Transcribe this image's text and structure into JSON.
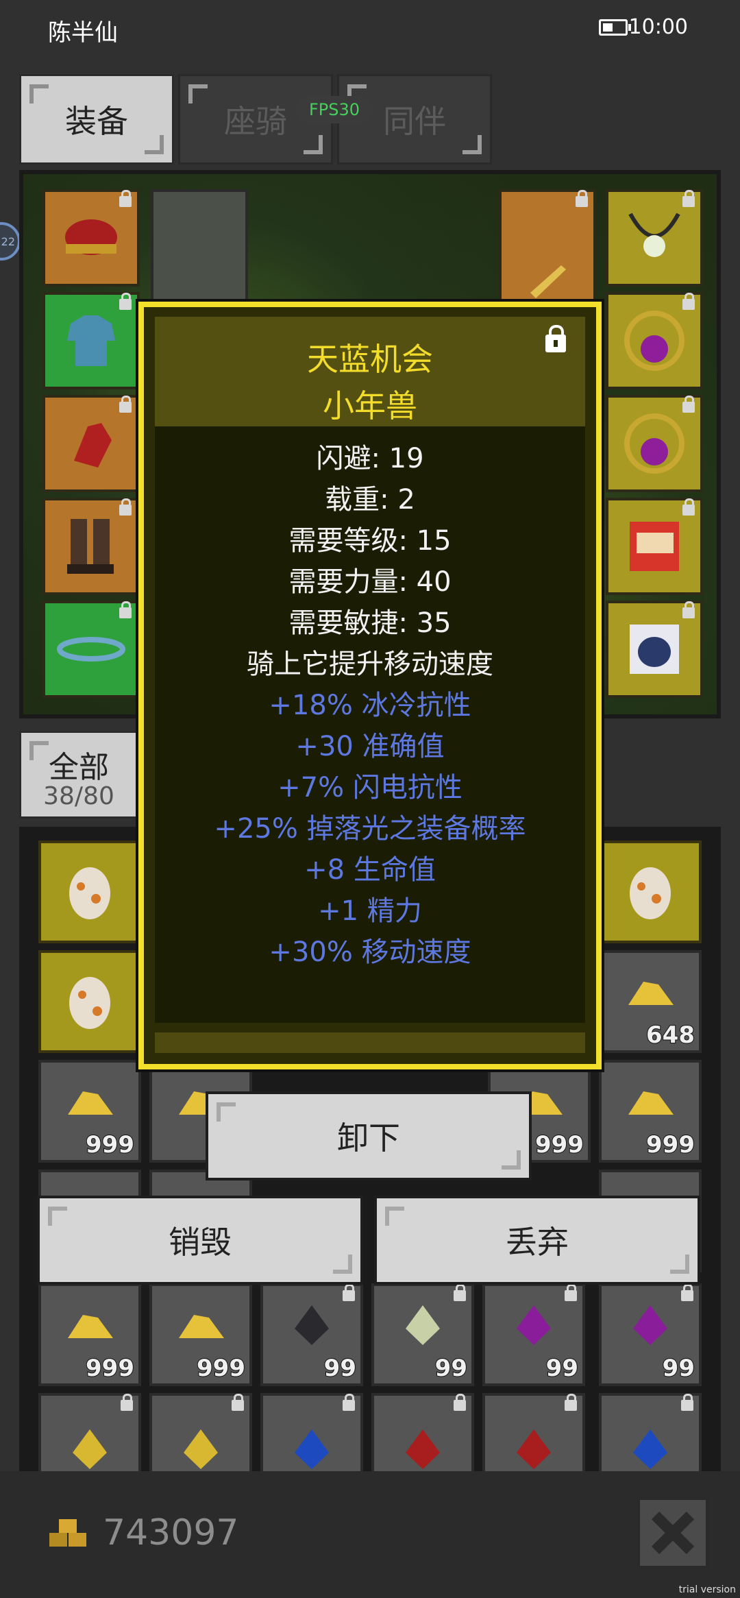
{
  "status_bar": {
    "name": "陈半仙",
    "time": "10:00"
  },
  "tabs": [
    {
      "label": "装备",
      "active": true
    },
    {
      "label": "座骑",
      "active": false
    },
    {
      "label": "同伴",
      "active": false
    }
  ],
  "fps": "FPS30",
  "side_badge": "22",
  "tooltip": {
    "title": "天蓝机会",
    "subtitle": "小年兽",
    "stats": [
      "闪避: 19",
      "载重: 2",
      "需要等级: 15",
      "需要力量: 40",
      "需要敏捷: 35",
      "骑上它提升移动速度"
    ],
    "bonuses": [
      "+18% 冰冷抗性",
      "+30 准确值",
      "+7% 闪电抗性",
      "+25% 掉落光之装备概率",
      "+8 生命值",
      "+1 精力",
      "+30% 移动速度"
    ],
    "colors": {
      "title": "#f3dd2a",
      "stat": "#f2f2f2",
      "bonus": "#5d78e0",
      "border": "#f2e02a"
    }
  },
  "inventory": {
    "filter_label": "全部",
    "count": "38/80",
    "quantities": {
      "row1_last": "648",
      "row2": [
        "999",
        "999",
        "999",
        "999"
      ],
      "row4": [
        "999",
        "999",
        "99",
        "99",
        "99",
        "99"
      ]
    }
  },
  "actions": {
    "unequip": "卸下",
    "destroy": "销毁",
    "drop": "丢弃"
  },
  "gold": "743097",
  "trial_text": "trial version"
}
